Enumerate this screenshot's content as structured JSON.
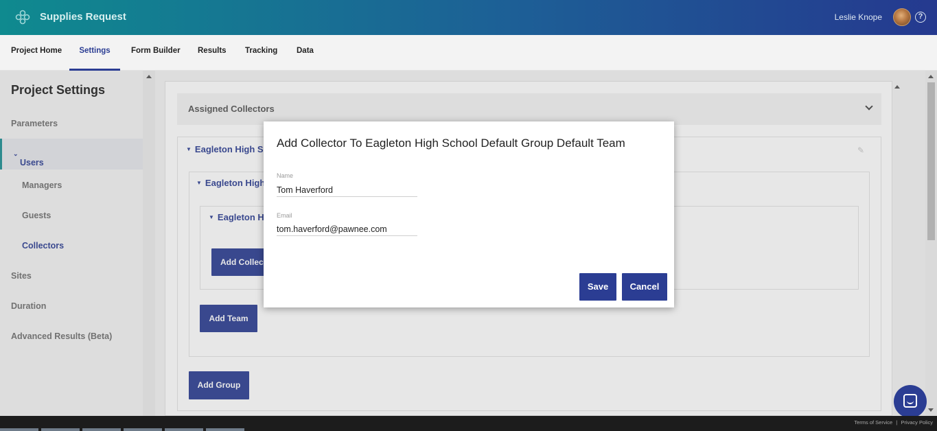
{
  "header": {
    "title": "Supplies Request",
    "user_name": "Leslie Knope",
    "help_symbol": "?"
  },
  "tabs": [
    {
      "label": "Project Home"
    },
    {
      "label": "Settings"
    },
    {
      "label": "Form Builder"
    },
    {
      "label": "Results"
    },
    {
      "label": "Tracking"
    },
    {
      "label": "Data"
    }
  ],
  "sidebar": {
    "title": "Project Settings",
    "items": {
      "parameters": "Parameters",
      "users": "Users",
      "managers": "Managers",
      "guests": "Guests",
      "collectors": "Collectors",
      "sites": "Sites",
      "duration": "Duration",
      "advanced_results": "Advanced Results (Beta)"
    }
  },
  "main": {
    "section_title": "Assigned Collectors",
    "tree": {
      "school": "Eagleton High S",
      "group": "Eagleton High",
      "team": "Eagleton H"
    },
    "buttons": {
      "add_collector": "Add Collec",
      "add_team": "Add Team",
      "add_group": "Add Group"
    }
  },
  "modal": {
    "title": "Add Collector To Eagleton High School Default Group Default Team",
    "name_label": "Name",
    "name_value": "Tom Haverford",
    "email_label": "Email",
    "email_value": "tom.haverford@pawnee.com",
    "save_label": "Save",
    "cancel_label": "Cancel"
  },
  "footer": {
    "terms": "Terms of Service",
    "separator": "|",
    "privacy": "Privacy Policy"
  },
  "colors": {
    "accent": "#2b3d93",
    "teal": "#0f8a8f"
  },
  "icons": [
    "logo-icon",
    "help-icon",
    "chevron-down-icon",
    "pencil-icon",
    "chat-icon"
  ]
}
